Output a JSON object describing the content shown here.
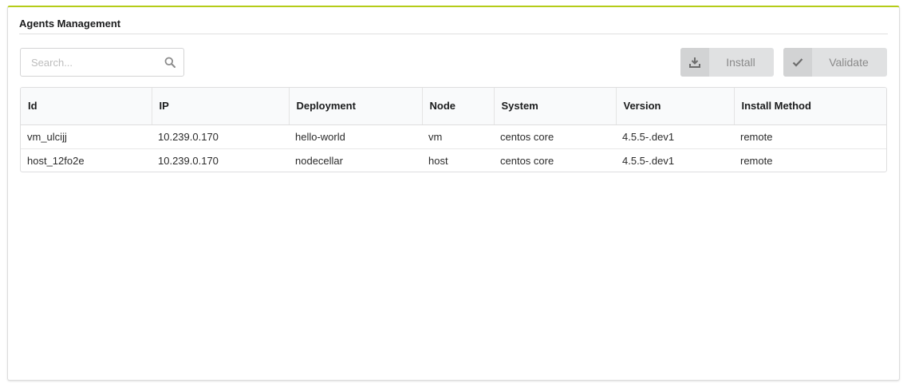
{
  "widget": {
    "title": "Agents Management",
    "accent_color": "#b5cc18"
  },
  "search": {
    "placeholder": "Search...",
    "value": "",
    "icon": "search-icon"
  },
  "toolbar": {
    "install_label": "Install",
    "install_icon": "download-icon",
    "validate_label": "Validate",
    "validate_icon": "checkmark-icon"
  },
  "table": {
    "columns": [
      "Id",
      "IP",
      "Deployment",
      "Node",
      "System",
      "Version",
      "Install Method"
    ],
    "rows": [
      [
        "vm_ulcijj",
        "10.239.0.170",
        "hello-world",
        "vm",
        "centos core",
        "4.5.5-.dev1",
        "remote"
      ],
      [
        "host_12fo2e",
        "10.239.0.170",
        "nodecellar",
        "host",
        "centos core",
        "4.5.5-.dev1",
        "remote"
      ]
    ]
  }
}
